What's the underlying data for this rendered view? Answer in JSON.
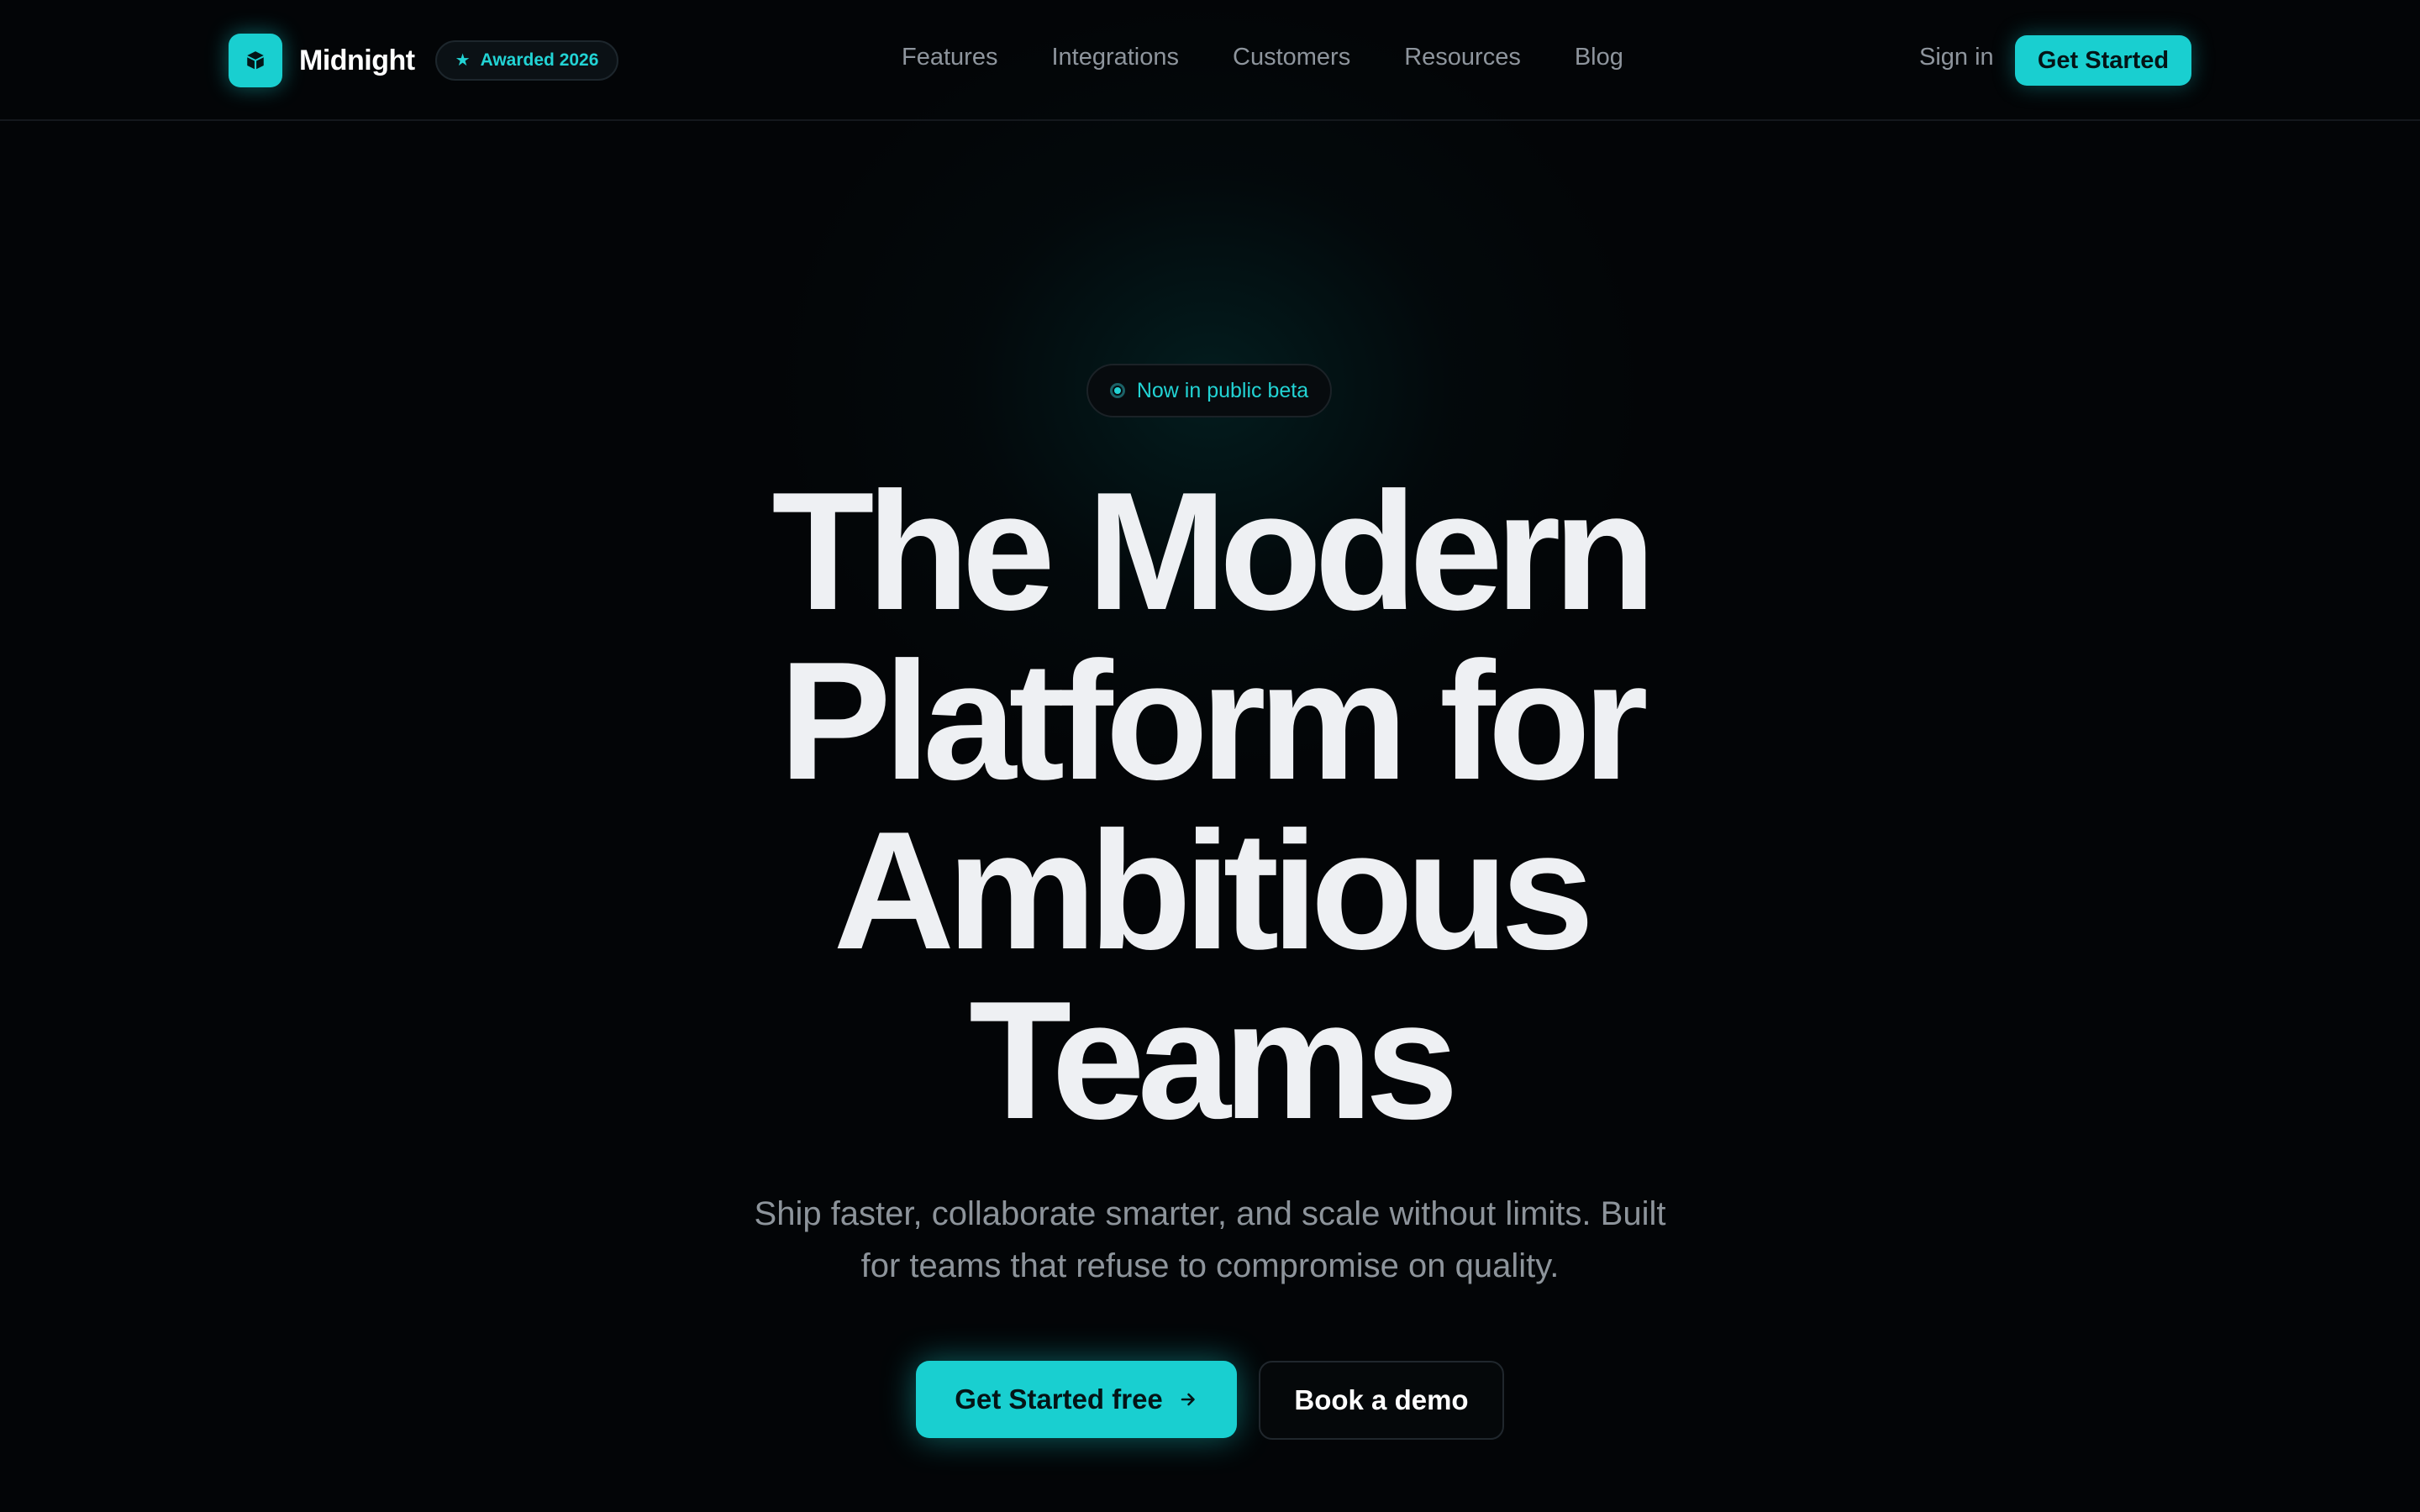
{
  "brand": {
    "name": "Midnight",
    "award_badge": "Awarded 2026",
    "logo_icon": "cube-icon",
    "accent_color": "#19cfd0"
  },
  "nav": {
    "items": [
      "Features",
      "Integrations",
      "Customers",
      "Resources",
      "Blog"
    ]
  },
  "header": {
    "sign_in": "Sign in",
    "cta": "Get Started"
  },
  "hero": {
    "beta_badge": "Now in public beta",
    "headline_lines": [
      "The Modern",
      "Platform for",
      "Ambitious",
      "Teams"
    ],
    "subheadline_lines": [
      "Ship faster, collaborate smarter, and scale without limits. Built",
      "for teams that refuse to compromise on quality."
    ],
    "primary_cta": "Get Started free",
    "primary_cta_icon": "arrow-right-icon",
    "secondary_cta": "Book a demo"
  }
}
